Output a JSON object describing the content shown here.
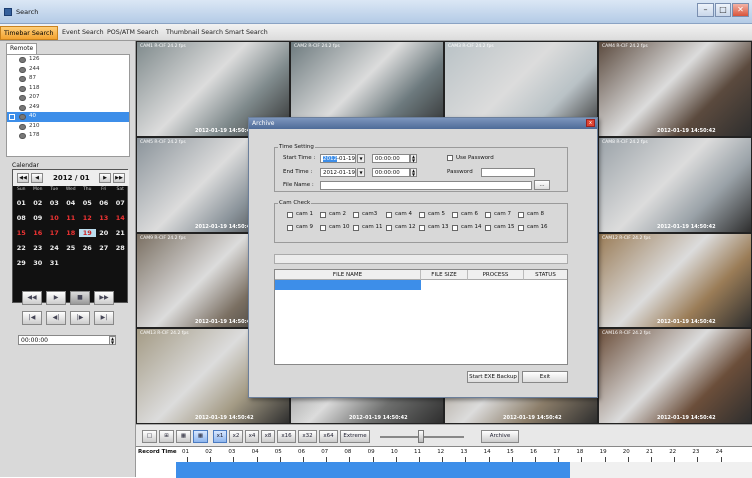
{
  "window": {
    "title": "Search"
  },
  "tabs": [
    "Timebar Search",
    "Event Search",
    "POS/ATM Search",
    "Thumbnail Search",
    "Smart Search"
  ],
  "remote": {
    "tab_label": "Remote",
    "items": [
      "126",
      "244",
      "87",
      "118",
      "207",
      "249",
      "40",
      "210",
      "178"
    ],
    "selected_index": 6
  },
  "calendar": {
    "label": "Calendar",
    "month": "2012 / 01",
    "weekdays": [
      "Sun",
      "Mon",
      "Tue",
      "Wed",
      "Thu",
      "Fri",
      "Sat"
    ],
    "days": [
      "01",
      "02",
      "03",
      "04",
      "05",
      "06",
      "07",
      "08",
      "09",
      "10",
      "11",
      "12",
      "13",
      "14",
      "15",
      "16",
      "17",
      "18",
      "19",
      "20",
      "21",
      "22",
      "23",
      "24",
      "25",
      "26",
      "27",
      "28",
      "29",
      "30",
      "31"
    ],
    "red_days": [
      "10",
      "11",
      "12",
      "13",
      "14",
      "15",
      "16",
      "17",
      "18",
      "19"
    ],
    "selected": "19",
    "nav": [
      "◀◀",
      "◀",
      "▶",
      "▶▶"
    ]
  },
  "playback": {
    "row1": [
      "◀◀",
      "▶",
      "■",
      "▶▶"
    ],
    "row2": [
      "|◀",
      "◀|",
      "|▶",
      "▶|"
    ],
    "time": "00:00:00"
  },
  "tiles": [
    {
      "label": "CAM1 R-CIF 24.2 fps",
      "ts": "2012-01-19 14:50:42"
    },
    {
      "label": "CAM2 R-CIF 24.2 fps",
      "ts": "2012-01-19 14:50:42"
    },
    {
      "label": "CAM3 R-CIF 24.2 fps",
      "ts": "2012-01-19 14:50:42"
    },
    {
      "label": "CAM4 R-CIF 24.2 fps",
      "ts": "2012-01-19 14:50:42"
    },
    {
      "label": "CAM5 R-CIF 24.2 fps",
      "ts": "2012-01-19 14:50:42"
    },
    {
      "label": "",
      "ts": ""
    },
    {
      "label": "",
      "ts": ""
    },
    {
      "label": "CAM8 R-CIF 24.2 fps",
      "ts": "2012-01-19 14:50:42"
    },
    {
      "label": "CAM9 R-CIF 24.2 fps",
      "ts": "2012-01-19 14:50:42"
    },
    {
      "label": "",
      "ts": ""
    },
    {
      "label": "",
      "ts": ""
    },
    {
      "label": "CAM12 R-CIF 24.2 fps",
      "ts": "2012-01-19 14:50:42"
    },
    {
      "label": "CAM13 R-CIF 24.2 fps",
      "ts": "2012-01-19 14:50:42"
    },
    {
      "label": "CAM14 R-CIF 24.2 fps",
      "ts": "2012-01-19 14:50:42"
    },
    {
      "label": "CAM15 R-CIF 24.2 fps",
      "ts": "2012-01-19 14:50:42"
    },
    {
      "label": "CAM16 R-CIF 24.2 fps",
      "ts": "2012-01-19 14:50:42"
    }
  ],
  "tile_colors": [
    "#7f8a8c",
    "#6d7a7e",
    "#b9c2c6",
    "#5b4a3e",
    "#8a939a",
    "#4a4f55",
    "#4b5257",
    "#9aa2a8",
    "#7a6f62",
    "#50565c",
    "#565c62",
    "#9a7c57",
    "#a49b85",
    "#6e6f6e",
    "#8c7e6a",
    "#6b4e3a"
  ],
  "toolbar": {
    "speeds": [
      "x1",
      "x2",
      "x4",
      "x8",
      "x16",
      "x32",
      "x64",
      "Extreme"
    ],
    "archive": "Archive"
  },
  "record": {
    "label": "Record Time",
    "hours": [
      "01",
      "02",
      "03",
      "04",
      "05",
      "06",
      "07",
      "08",
      "09",
      "10",
      "11",
      "12",
      "13",
      "14",
      "15",
      "16",
      "17",
      "18",
      "19",
      "20",
      "21",
      "22",
      "23",
      "24"
    ],
    "recorded_until_hour": 17
  },
  "archive_dialog": {
    "title": "Archive",
    "close": "x",
    "time_setting": "Time Setting",
    "start_label": "Start Time :",
    "start_date_highlight": "2012",
    "start_date_rest": "-01-19",
    "start_time": "00:00:00",
    "end_label": "End Time :",
    "end_date": "2012-01-19",
    "end_time": "00:00:00",
    "use_password": "Use Password",
    "password_label": "Password",
    "file_name_label": "File Name :",
    "browse": "...",
    "cam_check": "Cam Check",
    "cams": [
      "cam 1",
      "cam 2",
      "cam3",
      "cam 4",
      "cam 5",
      "cam 6",
      "cam 7",
      "cam 8",
      "cam 9",
      "cam 10",
      "cam 11",
      "cam 12",
      "cam 13",
      "cam 14",
      "cam 15",
      "cam 16"
    ],
    "columns": [
      "FILE NAME",
      "FILE SIZE",
      "PROCESS",
      "STATUS"
    ],
    "start_backup": "Start EXE Backup",
    "exit": "Exit"
  }
}
